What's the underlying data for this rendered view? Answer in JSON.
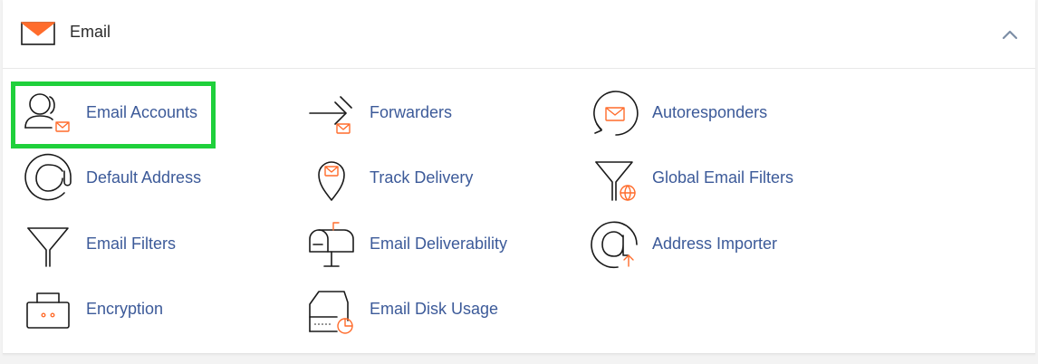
{
  "section": {
    "title": "Email",
    "header_icon": "envelope-icon",
    "toggle_icon": "chevron-up-icon"
  },
  "items": [
    {
      "label": "Email Accounts",
      "icon": "user-mail-icon"
    },
    {
      "label": "Forwarders",
      "icon": "forward-arrow-icon"
    },
    {
      "label": "Autoresponders",
      "icon": "autoresponder-icon"
    },
    {
      "label": "Default Address",
      "icon": "at-sign-icon"
    },
    {
      "label": "Track Delivery",
      "icon": "map-pin-mail-icon"
    },
    {
      "label": "Global Email Filters",
      "icon": "funnel-globe-icon"
    },
    {
      "label": "Email Filters",
      "icon": "funnel-icon"
    },
    {
      "label": "Email Deliverability",
      "icon": "mailbox-icon"
    },
    {
      "label": "Address Importer",
      "icon": "at-import-icon"
    },
    {
      "label": "Encryption",
      "icon": "lock-case-icon"
    },
    {
      "label": "Email Disk Usage",
      "icon": "disk-usage-icon"
    }
  ],
  "highlighted_item": "Email Accounts",
  "colors": {
    "accent": "#ff6c2c",
    "link": "#3c5a99",
    "highlight": "#1fd03b"
  }
}
